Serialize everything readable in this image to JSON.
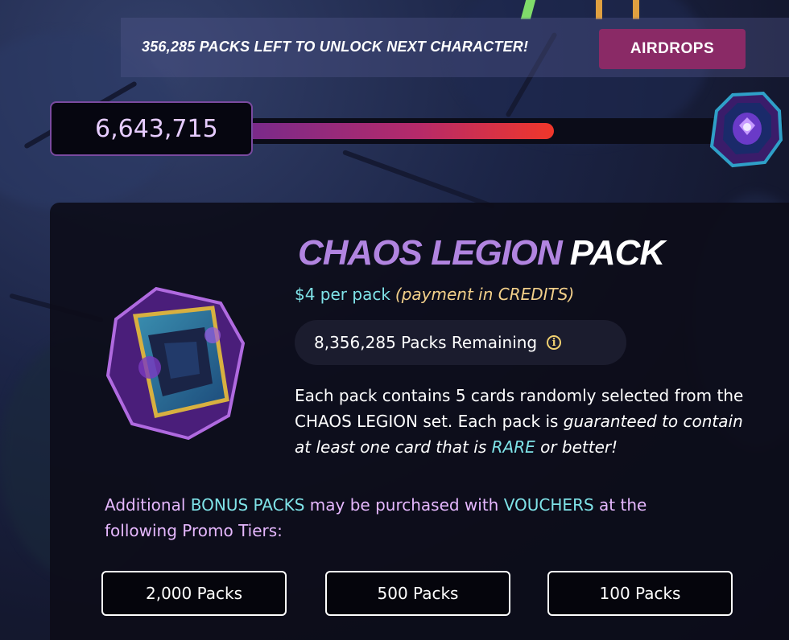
{
  "banner": {
    "text": "356,285 PACKS LEFT TO UNLOCK NEXT CHARACTER!",
    "airdrops_label": "AIRDROPS"
  },
  "progress": {
    "count": "6,643,715",
    "fill_fraction": 0.57
  },
  "pack": {
    "title_part1": "CHAOS LEGION",
    "title_part2": "PACK",
    "price": "$4 per pack",
    "payment_note": "(payment in CREDITS)",
    "remaining": "8,356,285 Packs Remaining",
    "description": {
      "part1": "Each pack contains 5 cards randomly selected from the CHAOS LEGION set. Each pack is ",
      "part2": "guaranteed to contain at least one card that is ",
      "rare": "RARE",
      "part3": " or better!"
    }
  },
  "bonus": {
    "part1": "Additional ",
    "hl1": "BONUS PACKS",
    "part2": " may be purchased with ",
    "hl2": "VOUCHERS",
    "part3": " at the following Promo Tiers:"
  },
  "tiers": [
    {
      "label": "2,000 Packs"
    },
    {
      "label": "500 Packs"
    },
    {
      "label": "100 Packs"
    }
  ],
  "colors": {
    "accent_purple": "#b184e0",
    "cyan": "#7fe3e8",
    "gold": "#f3d08a",
    "airdrops_bg": "#8a2a66"
  }
}
